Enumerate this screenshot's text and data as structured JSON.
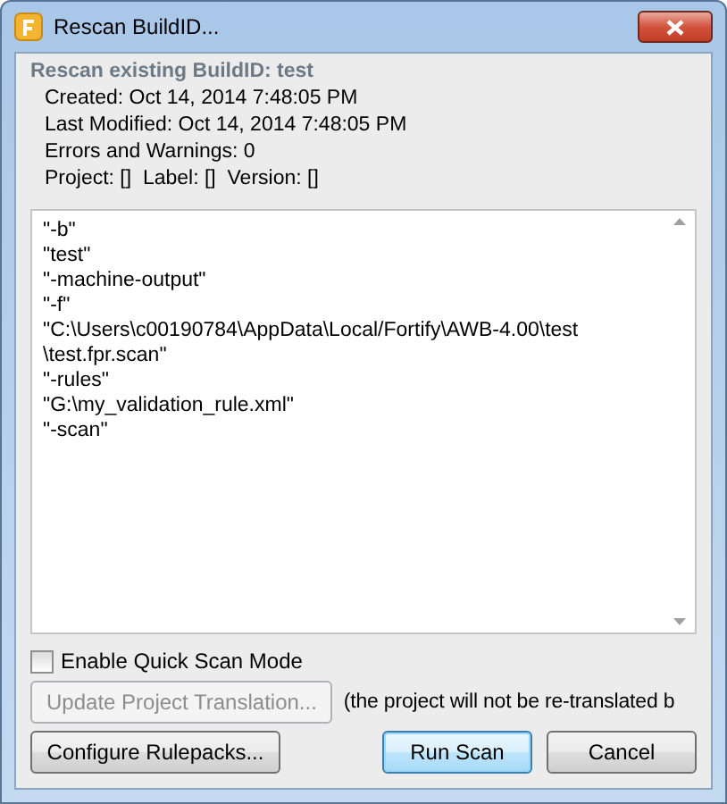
{
  "window": {
    "title": "Rescan BuildID..."
  },
  "header": "Rescan existing BuildID: test",
  "info": [
    "Created: Oct 14, 2014 7:48:05 PM",
    "Last Modified: Oct 14, 2014 7:48:05 PM",
    "Errors and Warnings: 0",
    "Project: []  Label: []  Version: []"
  ],
  "arguments": [
    "\"-b\"",
    "\"test\"",
    "\"-machine-output\"",
    "\"-f\"",
    "\"C:\\Users\\c00190784\\AppData\\Local/Fortify\\AWB-4.00\\test",
    "\\test.fpr.scan\"",
    "\"-rules\"",
    "\"G:\\my_validation_rule.xml\"",
    "\"-scan\""
  ],
  "quick_scan": {
    "label": "Enable Quick Scan Mode",
    "checked": false
  },
  "update_button": {
    "label": "Update Project Translation...",
    "disabled": true
  },
  "update_note": "(the project will not be re-translated b",
  "buttons": [
    {
      "label": "Configure Rulepacks...",
      "kind": "left",
      "default": false
    },
    {
      "label": "Run Scan",
      "kind": "right",
      "default": true
    },
    {
      "label": "Cancel",
      "kind": "right",
      "default": false
    }
  ]
}
